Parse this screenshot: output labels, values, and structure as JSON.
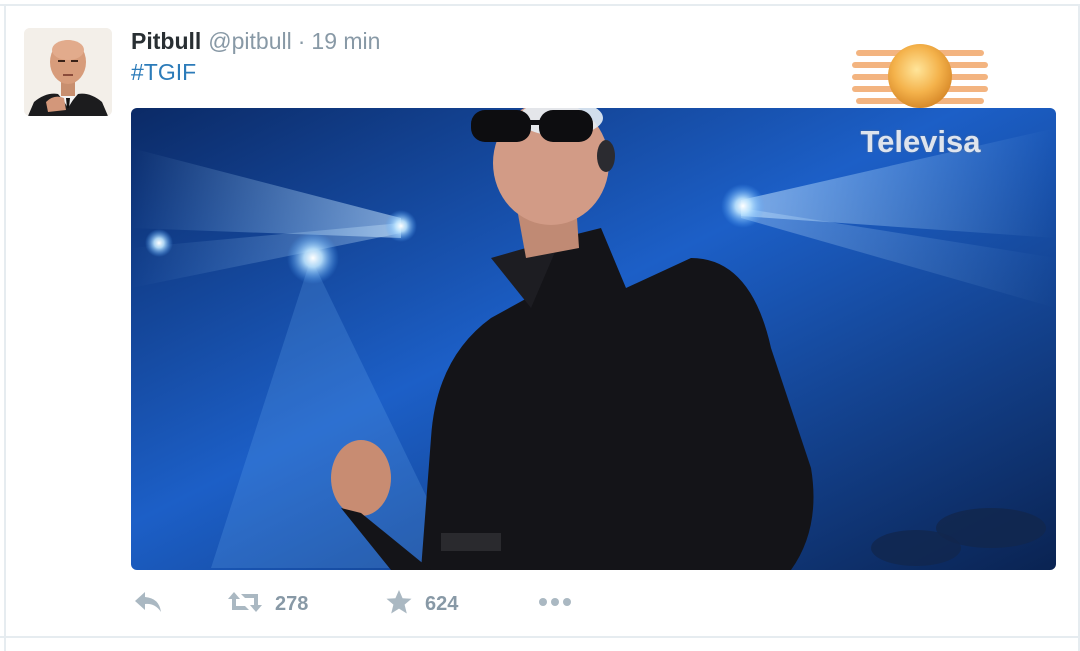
{
  "tweet": {
    "display_name": "Pitbull",
    "handle": "@pitbull",
    "separator": "·",
    "timestamp": "19 min",
    "text": "#TGIF"
  },
  "watermark": {
    "brand": "Televisa"
  },
  "actions": {
    "retweet_count": "278",
    "favorite_count": "624"
  },
  "colors": {
    "name": "#292f33",
    "meta": "#8899a6",
    "link": "#2b7bb9",
    "icon": "#aab8c2",
    "border": "#e6ecf0"
  },
  "icons": [
    "reply-icon",
    "retweet-icon",
    "favorite-icon",
    "more-icon"
  ]
}
